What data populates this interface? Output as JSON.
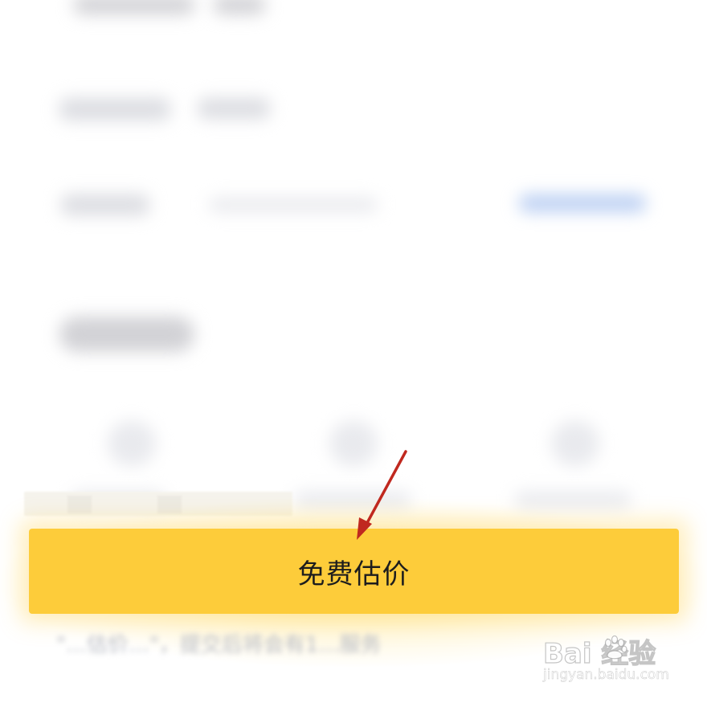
{
  "action_button": {
    "label": "免费估价"
  },
  "footnote": {
    "text": "\"…估价…\"，提交后将会有1…服务"
  },
  "watermark": {
    "logo_text": "Bai  经验",
    "url": "jingyan.baidu.com"
  },
  "annotation": {
    "type": "arrow",
    "color": "#c0281f",
    "target": "action-button"
  },
  "colors": {
    "button": "#fdcc3a",
    "button_text": "#1d1d1d",
    "blurred_link": "#bcd0f3"
  },
  "icons": [
    "paw-icon",
    "annotation-arrow-icon"
  ]
}
